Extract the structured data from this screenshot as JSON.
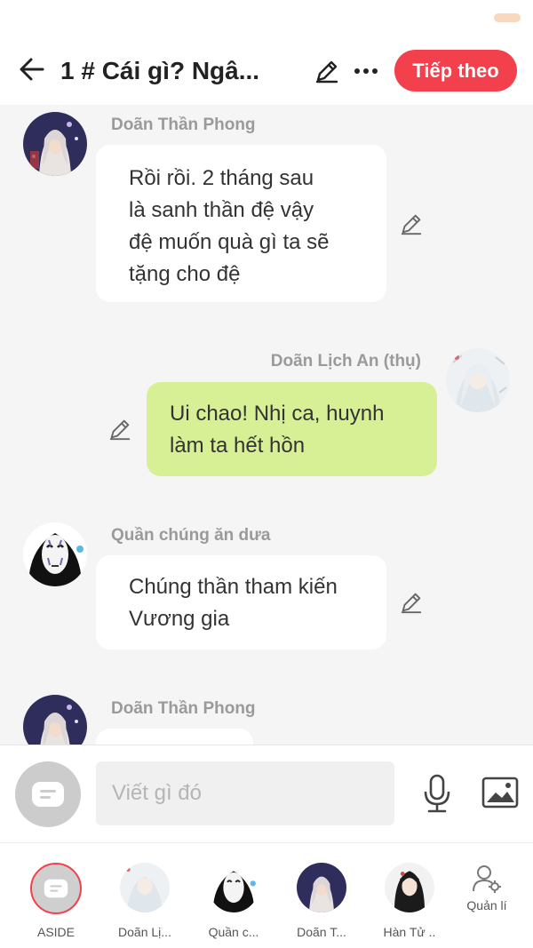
{
  "header": {
    "title": "1 # Cái gì? Ngâ...",
    "next_label": "Tiếp theo"
  },
  "messages": [
    {
      "sender": "Doãn Thần Phong",
      "side": "left",
      "avatar": "doan-than-phong",
      "lines": [
        "Rồi rồi. 2 tháng sau",
        "là sanh thần đệ vậy",
        "đệ muốn quà gì ta sẽ",
        "tặng cho đệ"
      ]
    },
    {
      "sender": "Doãn Lịch An (thụ)",
      "side": "right",
      "avatar": "doan-lich-an",
      "lines": [
        "Ui chao! Nhị ca, huynh",
        "làm ta hết hồn"
      ]
    },
    {
      "sender": "Quần chúng ăn dưa",
      "side": "left",
      "avatar": "quan-chung",
      "lines": [
        "Chúng thần tham kiến",
        "Vương gia"
      ]
    },
    {
      "sender": "Doãn Thần Phong",
      "side": "left",
      "avatar": "doan-than-phong",
      "lines": []
    }
  ],
  "input": {
    "placeholder": "Viết gì đó"
  },
  "characters": [
    {
      "label": "ASIDE",
      "avatar": "aside"
    },
    {
      "label": "Doãn Lị...",
      "avatar": "doan-lich-an"
    },
    {
      "label": "Quần c...",
      "avatar": "quan-chung"
    },
    {
      "label": "Doãn T...",
      "avatar": "doan-than-phong"
    },
    {
      "label": "Hàn Tử ..",
      "avatar": "han-tu"
    },
    {
      "label": "Quản lí",
      "avatar": "manage"
    }
  ],
  "colors": {
    "accent": "#f2404d",
    "right_bubble": "#d8f095",
    "left_bubble": "#ffffff",
    "background": "#f5f5f5"
  }
}
